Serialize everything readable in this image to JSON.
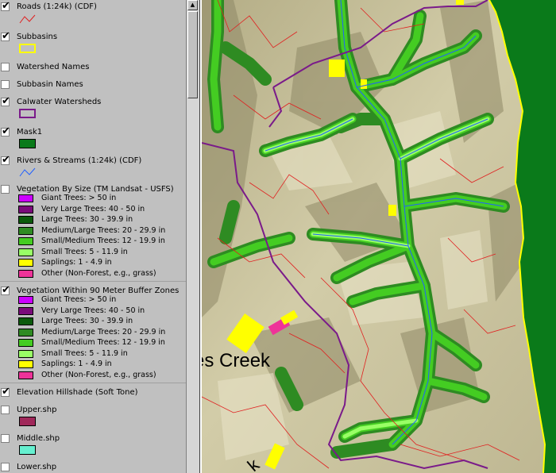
{
  "legend": {
    "layers": [
      {
        "id": "roads",
        "name": "Roads (1:24k) (CDF)",
        "checked": true,
        "symbol": "red-line-icon"
      },
      {
        "id": "subbasins",
        "name": "Subbasins",
        "checked": true,
        "symbol": "yellow-polygon-icon"
      },
      {
        "id": "watershed_names",
        "name": "Watershed Names",
        "checked": false
      },
      {
        "id": "subbasin_names",
        "name": "Subbasin Names",
        "checked": false
      },
      {
        "id": "calwater",
        "name": "Calwater Watersheds",
        "checked": true,
        "symbol": "purple-polygon-icon"
      },
      {
        "id": "mask1",
        "name": "Mask1",
        "checked": true,
        "symbol": "green-fill-icon"
      },
      {
        "id": "rivers",
        "name": "Rivers & Streams (1:24k) (CDF)",
        "checked": true,
        "symbol": "blue-line-icon"
      },
      {
        "id": "veg_size",
        "name": "Vegetation By Size (TM Landsat - USFS)",
        "checked": false
      },
      {
        "id": "veg_buffer",
        "name": "Vegetation Within 90 Meter Buffer Zones",
        "checked": true
      },
      {
        "id": "hillshade",
        "name": "Elevation Hillshade (Soft Tone)",
        "checked": true
      },
      {
        "id": "upper",
        "name": "Upper.shp",
        "checked": false,
        "symbol": "maroon-fill-icon"
      },
      {
        "id": "middle",
        "name": "Middle.shp",
        "checked": false,
        "symbol": "aqua-fill-icon"
      },
      {
        "id": "lower",
        "name": "Lower.shp",
        "checked": false
      }
    ],
    "veg_classes": [
      {
        "label": "Giant Trees: > 50 in",
        "color": "#cc00ff"
      },
      {
        "label": "Very Large Trees: 40 - 50 in",
        "color": "#7a0a7a"
      },
      {
        "label": "Large Trees: 30 - 39.9 in",
        "color": "#0b5a0b"
      },
      {
        "label": "Medium/Large Trees: 20 - 29.9 in",
        "color": "#2e8b22"
      },
      {
        "label": "Small/Medium Trees: 12 - 19.9 in",
        "color": "#44cc22"
      },
      {
        "label": "Small Trees: 5 - 11.9 in",
        "color": "#99ff66"
      },
      {
        "label": "Saplings: 1 - 4.9 in",
        "color": "#ffff00"
      },
      {
        "label": "Other (Non-Forest, e.g., grass)",
        "color": "#ee3399"
      }
    ]
  },
  "map": {
    "labels": [
      "es Creek",
      "k"
    ],
    "colors": {
      "hillshade": "#c9c3a0",
      "mask": "#0a7a1a",
      "subbasin": "#ffff00",
      "watershed": "#7a1a8a",
      "road": "#e02020",
      "stream": "#2060ff"
    }
  }
}
